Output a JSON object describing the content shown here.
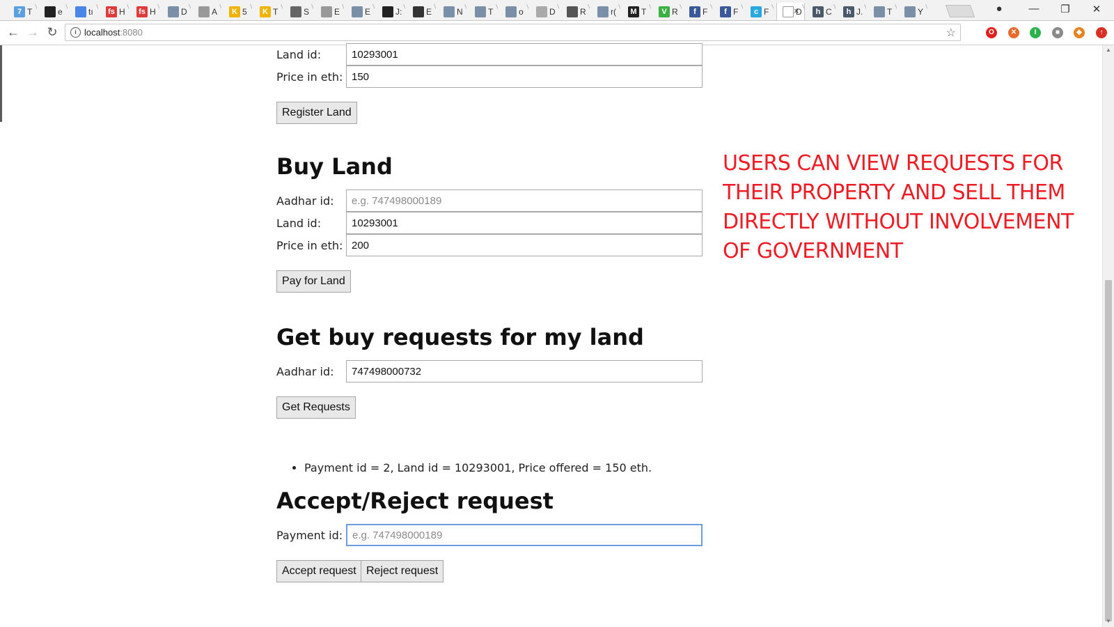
{
  "browser": {
    "tabs": [
      {
        "icon": "seven-icon",
        "fav_text": "7",
        "fav_color": "#5aa0e0",
        "title": "T"
      },
      {
        "icon": "github-icon",
        "fav_text": "",
        "fav_color": "#222222",
        "title": "e"
      },
      {
        "icon": "calendar-icon",
        "fav_text": "",
        "fav_color": "#4a86e8",
        "title": "tı"
      },
      {
        "icon": "fs-icon",
        "fav_text": "fs",
        "fav_color": "#e03a3a",
        "title": "H"
      },
      {
        "icon": "fs-icon",
        "fav_text": "fs",
        "fav_color": "#e03a3a",
        "title": "H"
      },
      {
        "icon": "reddit-icon",
        "fav_text": "",
        "fav_color": "#7a8fa8",
        "title": "D"
      },
      {
        "icon": "doc-icon",
        "fav_text": "",
        "fav_color": "#999999",
        "title": "A"
      },
      {
        "icon": "k-icon",
        "fav_text": "K",
        "fav_color": "#f0b400",
        "title": "5"
      },
      {
        "icon": "k-icon",
        "fav_text": "K",
        "fav_color": "#f0b400",
        "title": "T"
      },
      {
        "icon": "list-icon",
        "fav_text": "",
        "fav_color": "#666666",
        "title": "S"
      },
      {
        "icon": "doc-icon",
        "fav_text": "",
        "fav_color": "#999999",
        "title": "E"
      },
      {
        "icon": "reddit-icon",
        "fav_text": "",
        "fav_color": "#7a8fa8",
        "title": "E"
      },
      {
        "icon": "github-icon",
        "fav_text": "",
        "fav_color": "#222222",
        "title": "J:"
      },
      {
        "icon": "tag-icon",
        "fav_text": "",
        "fav_color": "#333333",
        "title": "E"
      },
      {
        "icon": "reddit-icon",
        "fav_text": "",
        "fav_color": "#7a8fa8",
        "title": "N"
      },
      {
        "icon": "reddit-icon",
        "fav_text": "",
        "fav_color": "#7a8fa8",
        "title": "T"
      },
      {
        "icon": "reddit-icon",
        "fav_text": "",
        "fav_color": "#7a8fa8",
        "title": "o"
      },
      {
        "icon": "lines-icon",
        "fav_text": "",
        "fav_color": "#aaaaaa",
        "title": "D"
      },
      {
        "icon": "eth-icon",
        "fav_text": "",
        "fav_color": "#555555",
        "title": "R"
      },
      {
        "icon": "reddit-icon",
        "fav_text": "",
        "fav_color": "#7a8fa8",
        "title": "r("
      },
      {
        "icon": "medium-icon",
        "fav_text": "M",
        "fav_color": "#222222",
        "title": "T"
      },
      {
        "icon": "v-icon",
        "fav_text": "V",
        "fav_color": "#3cb043",
        "title": "R"
      },
      {
        "icon": "facebook-icon",
        "fav_text": "f",
        "fav_color": "#3b5998",
        "title": "F"
      },
      {
        "icon": "facebook-icon",
        "fav_text": "f",
        "fav_color": "#3b5998",
        "title": "F"
      },
      {
        "icon": "c-icon",
        "fav_text": "c",
        "fav_color": "#29a8e0",
        "title": "F"
      },
      {
        "icon": "doc-icon",
        "fav_text": "",
        "fav_color": "#ffffff",
        "title": "D"
      },
      {
        "icon": "h-icon",
        "fav_text": "h",
        "fav_color": "#4b5a6b",
        "title": "C"
      },
      {
        "icon": "h-icon",
        "fav_text": "h",
        "fav_color": "#4b5a6b",
        "title": "J."
      },
      {
        "icon": "reddit-icon",
        "fav_text": "",
        "fav_color": "#7a8fa8",
        "title": "T"
      },
      {
        "icon": "reddit-icon",
        "fav_text": "",
        "fav_color": "#7a8fa8",
        "title": "Y"
      }
    ],
    "active_tab_index": 25,
    "active_tab_close": "×",
    "window_controls": {
      "minimize": "—",
      "restore": "❐",
      "close": "✕"
    },
    "url_host": "localhost",
    "url_port": ":8080",
    "extensions": [
      {
        "icon": "opera-icon",
        "text": "O",
        "color": "#e0201d"
      },
      {
        "icon": "circle-x-icon",
        "text": "✕",
        "color": "#e86a2a"
      },
      {
        "icon": "power-icon",
        "text": "I",
        "color": "#2bb24c"
      },
      {
        "icon": "puzzle-icon",
        "text": "■",
        "color": "#8a8a8a"
      },
      {
        "icon": "fox-icon",
        "text": "◆",
        "color": "#e8821e"
      },
      {
        "icon": "upload-icon",
        "text": "↑",
        "color": "#d93025"
      }
    ]
  },
  "register": {
    "land_id_label": "Land id:",
    "land_id_value": "10293001",
    "price_label": "Price in eth:",
    "price_value": "150",
    "button": "Register Land"
  },
  "buy": {
    "heading": "Buy Land",
    "aadhar_label": "Aadhar id:",
    "aadhar_placeholder": "e.g. 747498000189",
    "land_id_label": "Land id:",
    "land_id_value": "10293001",
    "price_label": "Price in eth:",
    "price_value": "200",
    "button": "Pay for Land"
  },
  "requests": {
    "heading": "Get buy requests for my land",
    "aadhar_label": "Aadhar id:",
    "aadhar_value": "747498000732",
    "button": "Get Requests",
    "items": [
      "Payment id = 2, Land id = 10293001, Price offered = 150 eth."
    ]
  },
  "accept": {
    "heading": "Accept/Reject request",
    "payment_label": "Payment id:",
    "payment_placeholder": "e.g. 747498000189",
    "accept_button": "Accept request",
    "reject_button": "Reject request"
  },
  "annotation": {
    "text": "USERS CAN VIEW REQUESTS FOR THEIR PROPERTY AND SELL THEM DIRECTLY WITHOUT INVOLVEMENT OF GOVERNMENT",
    "color": "#ee1c24"
  }
}
